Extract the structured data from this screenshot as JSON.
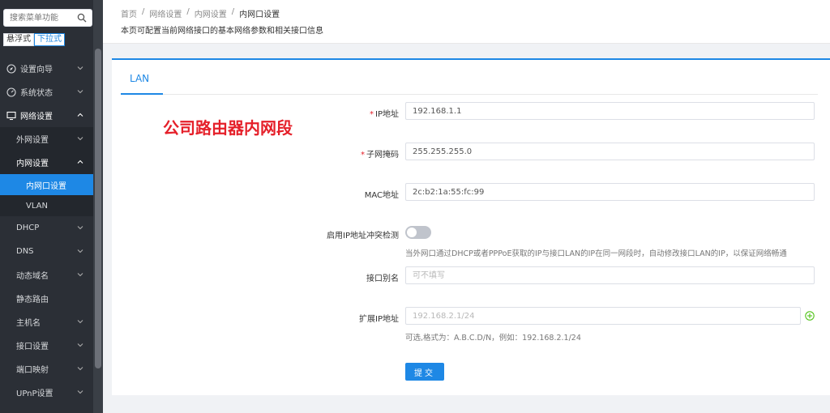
{
  "sidebar": {
    "search_placeholder": "搜索菜单功能",
    "mode_float": "悬浮式",
    "mode_dropdown": "下拉式",
    "items": [
      {
        "label": "设置向导",
        "icon": "compass-icon"
      },
      {
        "label": "系统状态",
        "icon": "gauge-icon"
      },
      {
        "label": "网络设置",
        "icon": "monitor-icon"
      }
    ],
    "sub_items": [
      {
        "label": "外网设置"
      },
      {
        "label": "内网设置"
      }
    ],
    "sub2_items": [
      {
        "label": "内网口设置"
      },
      {
        "label": "VLAN"
      }
    ],
    "more_items": [
      {
        "label": "DHCP"
      },
      {
        "label": "DNS"
      },
      {
        "label": "动态域名"
      },
      {
        "label": "静态路由"
      },
      {
        "label": "主机名"
      },
      {
        "label": "接口设置"
      },
      {
        "label": "端口映射"
      },
      {
        "label": "UPnP设置"
      }
    ]
  },
  "header": {
    "breadcrumb": [
      "首页",
      "/",
      "网络设置",
      "/",
      "内网设置",
      "/",
      "内网口设置"
    ],
    "description": "本页可配置当前网络接口的基本网络参数和相关接口信息"
  },
  "tab": {
    "label": "LAN"
  },
  "annotation": "公司路由器内网段",
  "form": {
    "ip_label": "IP地址",
    "ip_value": "192.168.1.1",
    "mask_label": "子网掩码",
    "mask_value": "255.255.255.0",
    "mac_label": "MAC地址",
    "mac_value": "2c:b2:1a:55:fc:99",
    "conflict_label": "启用IP地址冲突检测",
    "conflict_hint": "当外网口通过DHCP或者PPPoE获取的IP与接口LAN的IP在同一网段时，自动修改接口LAN的IP，以保证网络畅通",
    "alias_label": "接口别名",
    "alias_placeholder": "可不填写",
    "ext_label": "扩展IP地址",
    "ext_placeholder": "192.168.2.1/24",
    "ext_hint": "可选,格式为：A.B.C.D/N，例如：192.168.2.1/24",
    "submit_label": "提交",
    "required_mark": "*"
  },
  "colors": {
    "accent": "#1e88e5",
    "sidebar_bg": "#2b2f36",
    "annotation": "#e5202a",
    "add": "#52c41a"
  }
}
